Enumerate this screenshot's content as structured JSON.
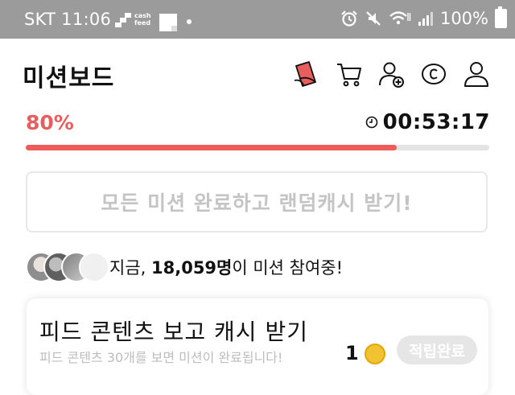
{
  "status_bar": {
    "carrier_time": "SKT 11:06",
    "cashfeed_label_1": "cash",
    "cashfeed_label_2": "feed",
    "battery": "100%"
  },
  "header": {
    "title": "미션보드",
    "icons": [
      "sticker-icon",
      "cart-icon",
      "add-user-icon",
      "cash-coin-icon",
      "profile-icon"
    ]
  },
  "progress": {
    "percent_label": "80%",
    "value": 0.8,
    "timer": "00:53:17"
  },
  "claim_button": {
    "label": "모든 미션 완료하고 랜덤캐시 받기!"
  },
  "participants": {
    "prefix": "지금, ",
    "count": "18,059명",
    "suffix": "이 미션 참여중!"
  },
  "mission_card": {
    "title": "피드 콘텐츠 보고 캐시 받기",
    "subtitle": "피드 콘텐츠 30개를 보면 미션이 완료됩니다!",
    "reward": "1",
    "button": "적립완료"
  },
  "colors": {
    "accent": "#ee5b5b",
    "status_bar": "#9b9b9b"
  }
}
